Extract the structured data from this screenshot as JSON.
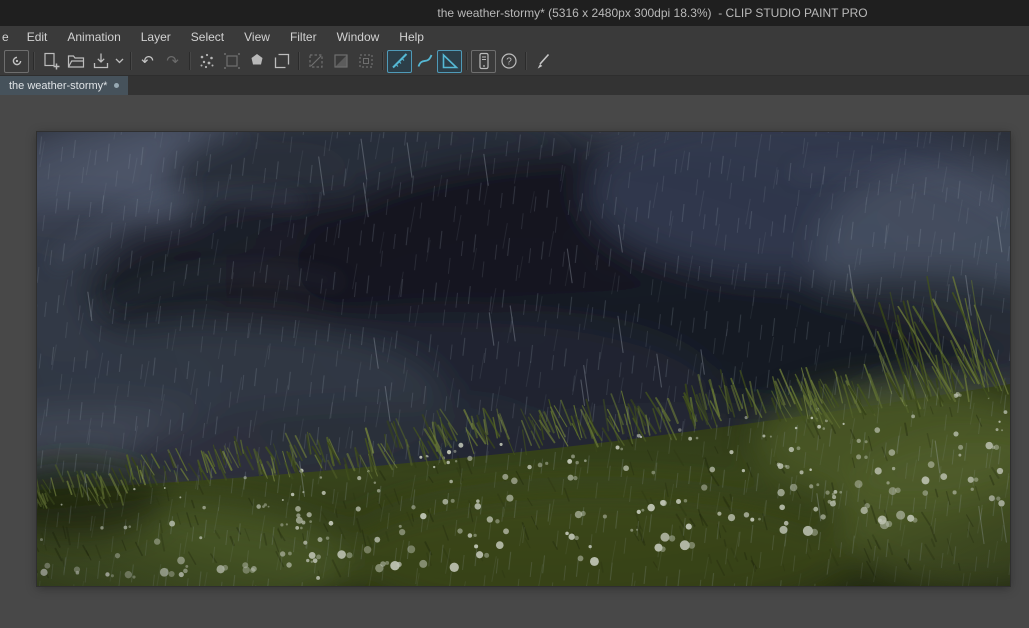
{
  "window": {
    "title": "the weather-stormy* (5316 x 2480px 300dpi 18.3%)  - CLIP STUDIO PAINT PRO"
  },
  "menubar": {
    "items": [
      {
        "id": "file-partial",
        "label": "e"
      },
      {
        "id": "edit",
        "label": "Edit"
      },
      {
        "id": "animation",
        "label": "Animation"
      },
      {
        "id": "layer",
        "label": "Layer"
      },
      {
        "id": "select",
        "label": "Select"
      },
      {
        "id": "view",
        "label": "View"
      },
      {
        "id": "filter",
        "label": "Filter"
      },
      {
        "id": "window",
        "label": "Window"
      },
      {
        "id": "help",
        "label": "Help"
      }
    ]
  },
  "toolbar": {
    "icons": [
      {
        "name": "clip-studio-logo",
        "state": "normal"
      },
      {
        "name": "new-canvas",
        "state": "normal"
      },
      {
        "name": "open-file",
        "state": "normal"
      },
      {
        "name": "save-file",
        "state": "normal"
      },
      {
        "name": "save-file-menu",
        "state": "normal"
      },
      {
        "name": "undo",
        "state": "normal"
      },
      {
        "name": "redo",
        "state": "disabled"
      },
      {
        "name": "clear",
        "state": "normal"
      },
      {
        "name": "clear-outside-selection",
        "state": "disabled"
      },
      {
        "name": "fill",
        "state": "normal"
      },
      {
        "name": "scale-rotate",
        "state": "normal"
      },
      {
        "name": "deselect",
        "state": "disabled"
      },
      {
        "name": "invert-selection",
        "state": "disabled"
      },
      {
        "name": "selection-border",
        "state": "disabled"
      },
      {
        "name": "snap-to-ruler",
        "state": "active"
      },
      {
        "name": "snap-to-special-ruler",
        "state": "normal"
      },
      {
        "name": "snap-to-grid",
        "state": "active"
      },
      {
        "name": "companion-mode",
        "state": "normal"
      },
      {
        "name": "help",
        "state": "normal"
      },
      {
        "name": "pen",
        "state": "normal"
      }
    ]
  },
  "tabbar": {
    "tabs": [
      {
        "label": "the weather-stormy*",
        "modified": true
      }
    ]
  },
  "canvas": {
    "artwork_description": "stormy dark clouds with rain over a windblown green field with white flowers",
    "colors": {
      "accent_teal": "#55b8d4",
      "chrome_dark": "#1f1f1f",
      "chrome": "#3a3a3a",
      "workspace_bg": "#484848",
      "tab_bg": "#46525b",
      "sky_dark": "#141820",
      "sky_light": "#59627a",
      "grass_dark": "#2f3a17",
      "grass_light": "#6b7d37",
      "flower": "#dfe5d3",
      "rain": "#c2cedd"
    }
  }
}
